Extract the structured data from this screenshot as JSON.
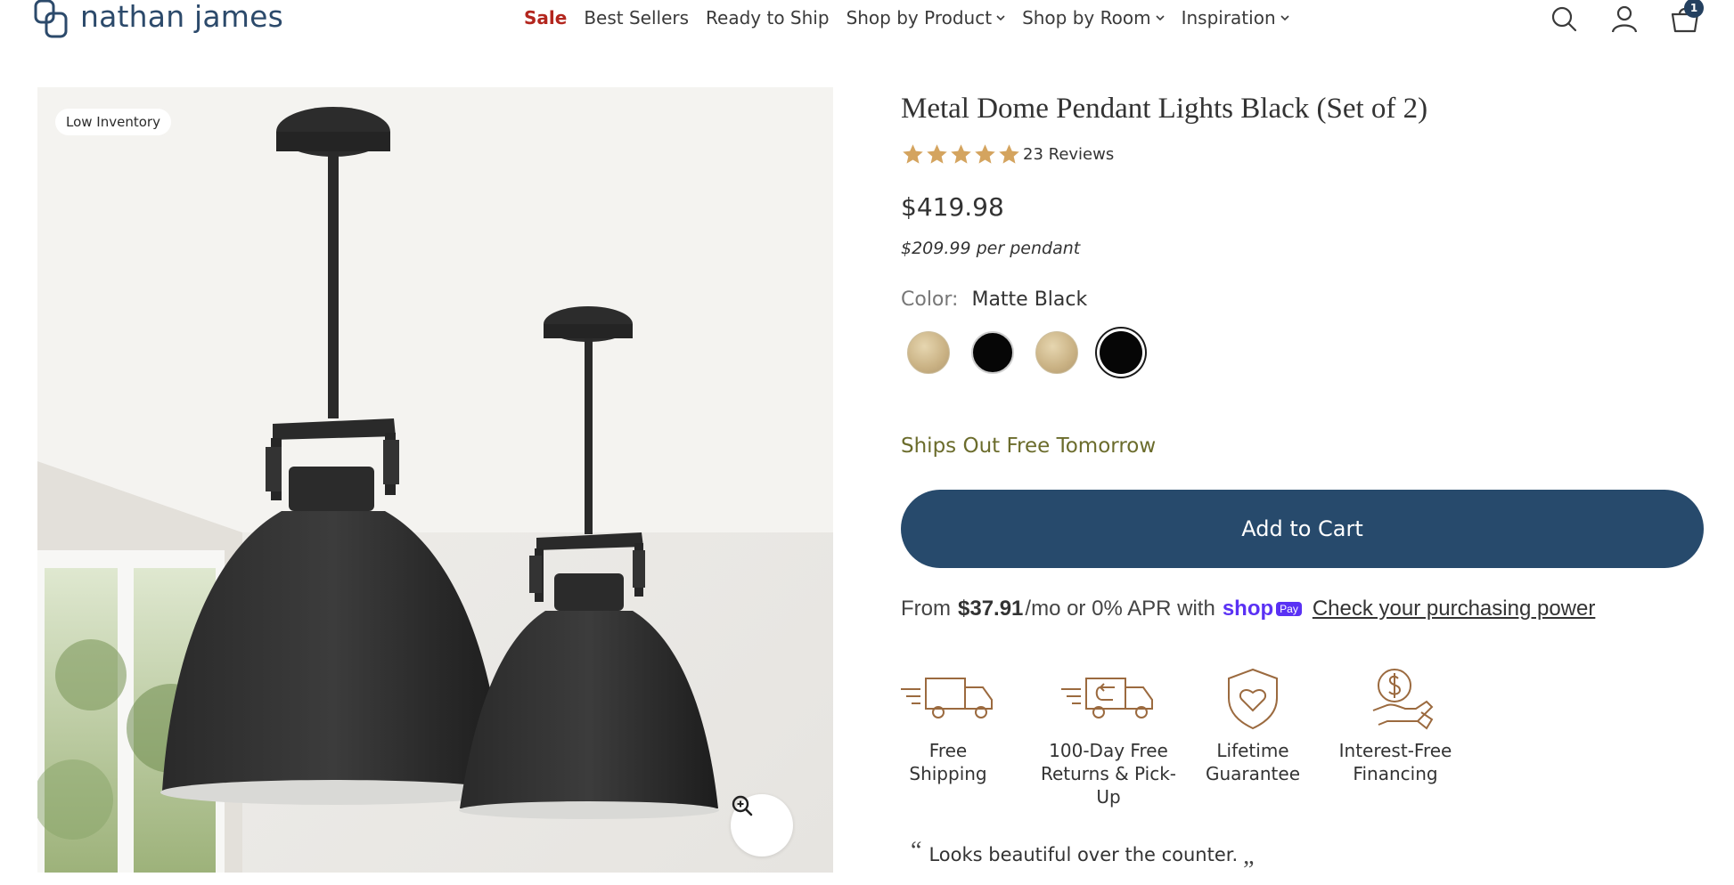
{
  "brand": {
    "name": "nathan james",
    "logo_icon": "nj-logo-icon"
  },
  "nav": {
    "items": [
      {
        "label": "Sale",
        "dropdown": false
      },
      {
        "label": "Best Sellers",
        "dropdown": false
      },
      {
        "label": "Ready to Ship",
        "dropdown": false
      },
      {
        "label": "Shop by Product",
        "dropdown": true
      },
      {
        "label": "Shop by Room",
        "dropdown": true
      },
      {
        "label": "Inspiration",
        "dropdown": true
      }
    ],
    "sale_color": "#b3261e"
  },
  "header_icons": {
    "search": "search-icon",
    "account": "account-icon",
    "cart": "cart-icon",
    "cart_count": "1"
  },
  "gallery": {
    "badge": "Low Inventory",
    "zoom_icon": "zoom-in-icon"
  },
  "product": {
    "title": "Metal Dome Pendant Lights Black (Set of 2)",
    "rating": 5,
    "review_count": "23 Reviews",
    "price": "$419.98",
    "per_unit": "$209.99 per pendant",
    "color_label": "Color:",
    "color_value": "Matte Black",
    "swatches": [
      {
        "name": "brass",
        "selected": false
      },
      {
        "name": "black",
        "selected": false
      },
      {
        "name": "brass",
        "selected": false
      },
      {
        "name": "black",
        "selected": true
      }
    ],
    "ships": "Ships Out Free Tomorrow",
    "add_to_cart": "Add to Cart",
    "accent_color": "#274a6c"
  },
  "financing": {
    "prefix": "From",
    "amount": "$37.91",
    "suffix": "/mo or 0% APR with",
    "shop_word": "shop",
    "pay_pill": "Pay",
    "link": "Check your purchasing power"
  },
  "features": [
    {
      "icon": "truck-icon",
      "line1": "Free",
      "line2": "Shipping"
    },
    {
      "icon": "return-truck-icon",
      "line1": "100-Day Free",
      "line2": "Returns & Pick-Up"
    },
    {
      "icon": "shield-heart-icon",
      "line1": "Lifetime",
      "line2": "Guarantee"
    },
    {
      "icon": "money-hand-icon",
      "line1": "Interest-Free",
      "line2": "Financing"
    }
  ],
  "quote": "Looks beautiful over the counter."
}
